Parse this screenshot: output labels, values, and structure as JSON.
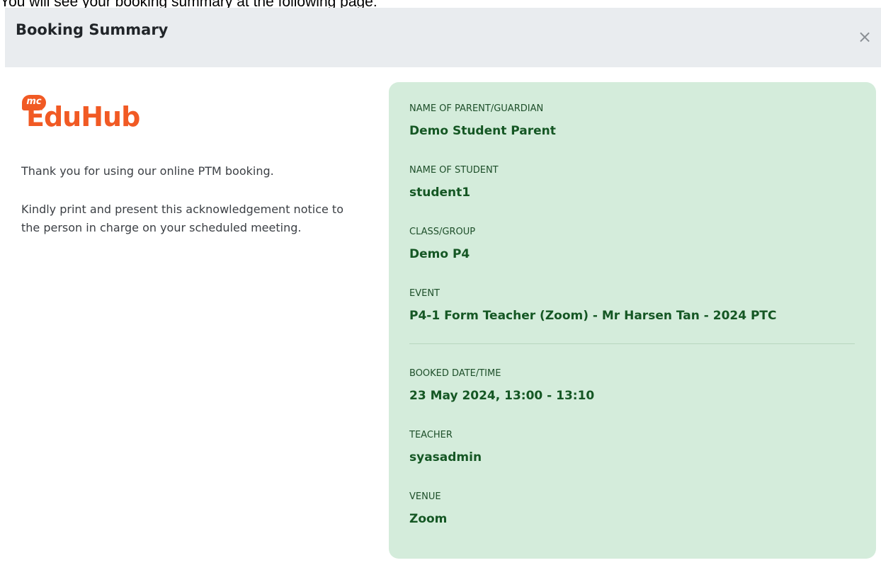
{
  "top_note": "You will see your booking summary at the following page:",
  "modal": {
    "title": "Booking Summary",
    "close_symbol": "×"
  },
  "brand": {
    "badge": "mc",
    "name": "EduHub",
    "color": "#f15a24"
  },
  "messages": {
    "thanks": "Thank you for using our online PTM booking.",
    "instruction": "Kindly print and present this acknowledgement notice to the person in charge on your scheduled meeting."
  },
  "summary": {
    "parent_label": "NAME OF PARENT/GUARDIAN",
    "parent_value": "Demo Student Parent",
    "student_label": "NAME OF STUDENT",
    "student_value": "student1",
    "class_label": "CLASS/GROUP",
    "class_value": "Demo P4",
    "event_label": "EVENT",
    "event_value": "P4-1 Form Teacher (Zoom) - Mr Harsen Tan - 2024 PTC",
    "datetime_label": "BOOKED DATE/TIME",
    "datetime_value": "23 May 2024, 13:00 - 13:10",
    "teacher_label": "TEACHER",
    "teacher_value": "syasadmin",
    "venue_label": "VENUE",
    "venue_value": "Zoom"
  },
  "colors": {
    "header_bg": "#e9ecef",
    "card_bg": "#d4ecdb",
    "card_text": "#155724"
  }
}
